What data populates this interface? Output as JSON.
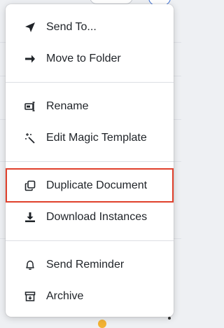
{
  "colors": {
    "highlight_outline": "#e0402c",
    "text": "#1f2328",
    "divider": "#dcdfe4"
  },
  "menu": {
    "groups": [
      {
        "items": [
          {
            "id": "send-to",
            "label": "Send To...",
            "icon": "paper-plane-icon"
          },
          {
            "id": "move-to-folder",
            "label": "Move to Folder",
            "icon": "arrow-right-icon"
          }
        ]
      },
      {
        "items": [
          {
            "id": "rename",
            "label": "Rename",
            "icon": "rename-field-icon"
          },
          {
            "id": "edit-magic-template",
            "label": "Edit Magic Template",
            "icon": "magic-wand-icon"
          }
        ]
      },
      {
        "items": [
          {
            "id": "duplicate-document",
            "label": "Duplicate Document",
            "icon": "duplicate-icon",
            "highlighted": true
          },
          {
            "id": "download-instances",
            "label": "Download Instances",
            "icon": "download-icon"
          }
        ]
      },
      {
        "items": [
          {
            "id": "send-reminder",
            "label": "Send Reminder",
            "icon": "bell-icon"
          },
          {
            "id": "archive",
            "label": "Archive",
            "icon": "archive-box-icon"
          }
        ]
      }
    ]
  }
}
